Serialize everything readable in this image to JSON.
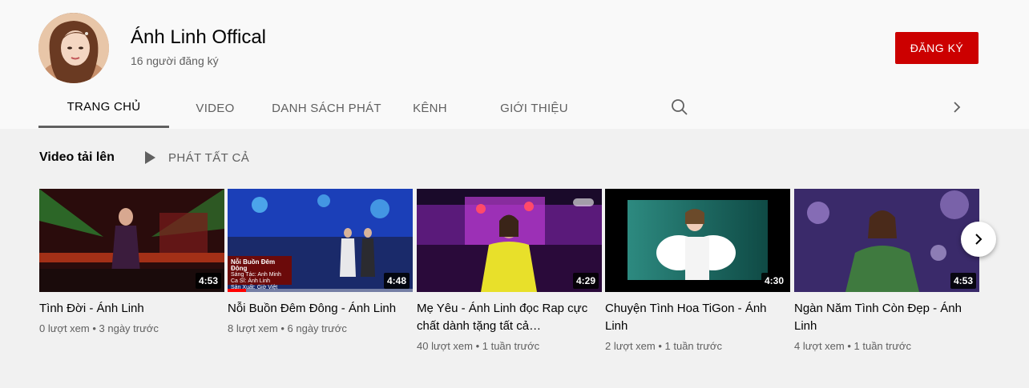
{
  "channel": {
    "name": "Ánh Linh Offical",
    "subscribers": "16 người đăng ký",
    "subscribe_label": "ĐĂNG KÝ",
    "accent": "#cc0000"
  },
  "tabs": [
    {
      "label": "TRANG CHỦ",
      "active": true
    },
    {
      "label": "VIDEO"
    },
    {
      "label": "DANH SÁCH PHÁT"
    },
    {
      "label": "KÊNH"
    },
    {
      "label": "GIỚI THIỆU"
    }
  ],
  "icons": {
    "search": "search-icon",
    "tabs_next": "chevron-right-icon",
    "play_all": "play-icon",
    "carousel_next": "chevron-right-icon"
  },
  "section": {
    "title": "Video tải lên",
    "play_all_label": "PHÁT TẤT CẢ"
  },
  "videos": [
    {
      "title": "Tình Đời - Ánh Linh",
      "duration": "4:53",
      "meta": "0 lượt xem • 3 ngày trước"
    },
    {
      "title": "Nỗi Buồn Đêm Đông - Ánh Linh",
      "duration": "4:48",
      "meta": "8 lượt xem • 6 ngày trước",
      "watched_fraction": 0.1
    },
    {
      "title": "Mẹ Yêu - Ánh Linh đọc Rap cực chất dành tặng tất cả…",
      "duration": "4:29",
      "meta": "40 lượt xem • 1 tuần trước"
    },
    {
      "title": "Chuyện Tình Hoa TiGon - Ánh Linh",
      "duration": "4:30",
      "meta": "2 lượt xem • 1 tuần trước"
    },
    {
      "title": "Ngàn Năm Tình Còn Đẹp - Ánh Linh",
      "duration": "4:53",
      "meta": "4 lượt xem • 1 tuần trước"
    }
  ],
  "thumb_overlay": {
    "title": "Nỗi Buồn Đêm Đông",
    "line1": "Sáng Tác: Anh Minh",
    "line2": "Ca Sĩ: Ánh Linh",
    "line3": "Sản Xuất: Giờ Việt"
  }
}
